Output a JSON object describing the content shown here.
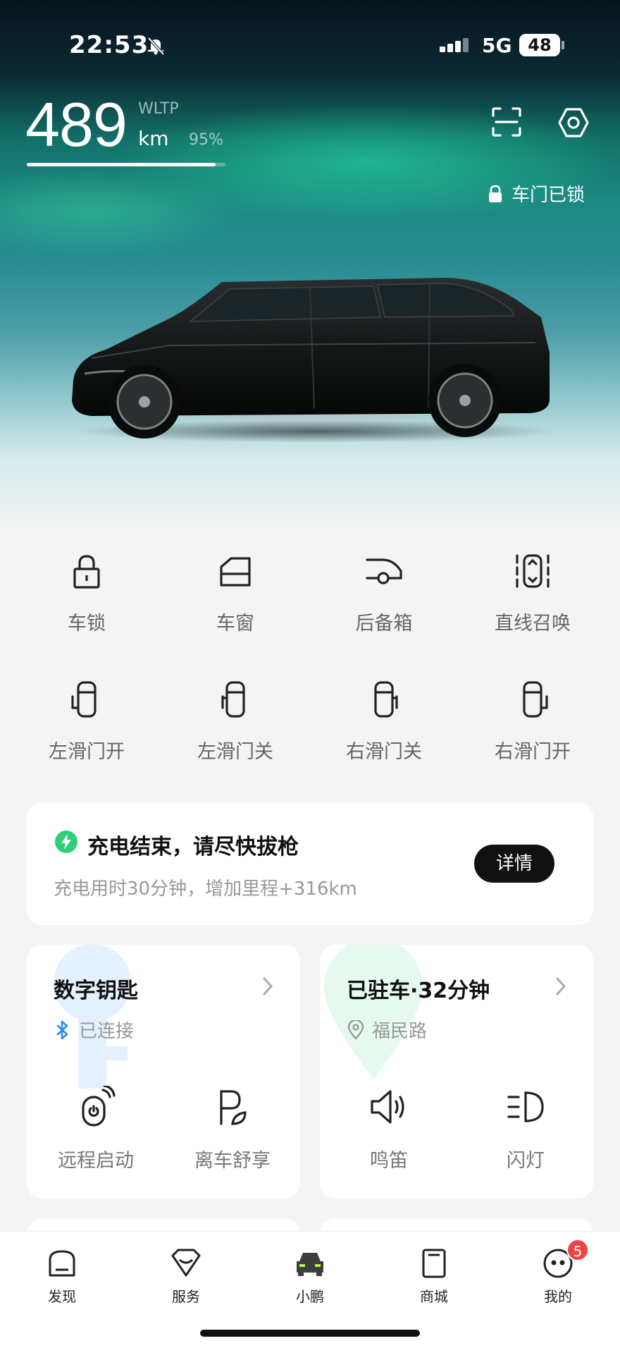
{
  "status_bar": {
    "time": "22:53",
    "network": "5G",
    "battery": "48"
  },
  "range": {
    "value": "489",
    "standard": "WLTP",
    "unit": "km",
    "percent_label": "95%",
    "percent_fill": 0.95
  },
  "door_status": "车门已锁",
  "controls": [
    {
      "label": "车锁",
      "icon": "lock-icon"
    },
    {
      "label": "车窗",
      "icon": "window-icon"
    },
    {
      "label": "后备箱",
      "icon": "trunk-icon"
    },
    {
      "label": "直线召唤",
      "icon": "summon-icon"
    },
    {
      "label": "左滑门开",
      "icon": "left-door-open-icon"
    },
    {
      "label": "左滑门关",
      "icon": "left-door-close-icon"
    },
    {
      "label": "右滑门关",
      "icon": "right-door-close-icon"
    },
    {
      "label": "右滑门开",
      "icon": "right-door-open-icon"
    }
  ],
  "charge": {
    "title": "充电结束，请尽快拔枪",
    "subtitle": "充电用时30分钟，增加里程+316km",
    "button": "详情"
  },
  "digital_key": {
    "title": "数字钥匙",
    "status": "已连接",
    "actions": [
      "远程启动",
      "离车舒享"
    ]
  },
  "parking": {
    "title": "已驻车·32分钟",
    "location": "福民路",
    "actions": [
      "鸣笛",
      "闪灯"
    ]
  },
  "tabs": [
    {
      "label": "发现",
      "icon": "discover-icon"
    },
    {
      "label": "服务",
      "icon": "service-icon"
    },
    {
      "label": "小鹏",
      "icon": "car-icon",
      "active": true
    },
    {
      "label": "商城",
      "icon": "shop-icon"
    },
    {
      "label": "我的",
      "icon": "profile-icon",
      "badge": "5"
    }
  ],
  "colors": {
    "accent_green": "#2fcf79",
    "bluetooth_blue": "#2b8cf0",
    "badge_red": "#ef4444"
  }
}
